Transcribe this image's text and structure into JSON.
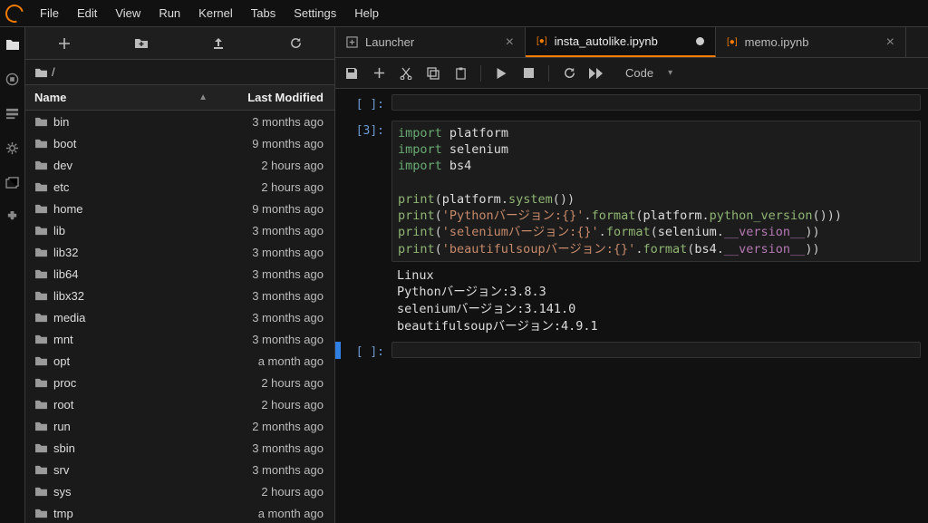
{
  "menu": {
    "items": [
      "File",
      "Edit",
      "View",
      "Run",
      "Kernel",
      "Tabs",
      "Settings",
      "Help"
    ]
  },
  "breadcrumb": "/",
  "filecols": {
    "name": "Name",
    "modified": "Last Modified"
  },
  "files": [
    {
      "name": "bin",
      "mod": "3 months ago"
    },
    {
      "name": "boot",
      "mod": "9 months ago"
    },
    {
      "name": "dev",
      "mod": "2 hours ago"
    },
    {
      "name": "etc",
      "mod": "2 hours ago"
    },
    {
      "name": "home",
      "mod": "9 months ago"
    },
    {
      "name": "lib",
      "mod": "3 months ago"
    },
    {
      "name": "lib32",
      "mod": "3 months ago"
    },
    {
      "name": "lib64",
      "mod": "3 months ago"
    },
    {
      "name": "libx32",
      "mod": "3 months ago"
    },
    {
      "name": "media",
      "mod": "3 months ago"
    },
    {
      "name": "mnt",
      "mod": "3 months ago"
    },
    {
      "name": "opt",
      "mod": "a month ago"
    },
    {
      "name": "proc",
      "mod": "2 hours ago"
    },
    {
      "name": "root",
      "mod": "2 hours ago"
    },
    {
      "name": "run",
      "mod": "2 months ago"
    },
    {
      "name": "sbin",
      "mod": "3 months ago"
    },
    {
      "name": "srv",
      "mod": "3 months ago"
    },
    {
      "name": "sys",
      "mod": "2 hours ago"
    },
    {
      "name": "tmp",
      "mod": "a month ago"
    }
  ],
  "tabs": [
    {
      "label": "Launcher",
      "active": false,
      "kind": "launcher",
      "dirty": false
    },
    {
      "label": "insta_autolike.ipynb",
      "active": true,
      "kind": "nb",
      "dirty": true
    },
    {
      "label": "memo.ipynb",
      "active": false,
      "kind": "nb",
      "dirty": false
    }
  ],
  "celltype": "Code",
  "cells": {
    "c0": {
      "prompt": "[ ]:"
    },
    "c1": {
      "prompt": "[3]:"
    },
    "c2": {
      "prompt": "[ ]:"
    }
  },
  "code": {
    "kw_import": "import",
    "mod_platform": "platform",
    "mod_selenium": "selenium",
    "mod_bs4": "bs4",
    "fn_print": "print",
    "dot": ".",
    "fn_system": "system",
    "fn_format": "format",
    "fn_pyver": "python_version",
    "attr_version": "__version__",
    "str_py": "'Pythonバージョン:{}'",
    "str_sel": "'seleniumバージョン:{}'",
    "str_bs": "'beautifulsoupバージョン:{}'",
    "op": "(",
    "cp": ")",
    "opp": "())",
    "opcp": "()))"
  },
  "output": {
    "l1": "Linux",
    "l2": "Pythonバージョン:3.8.3",
    "l3": "seleniumバージョン:3.141.0",
    "l4": "beautifulsoupバージョン:4.9.1"
  }
}
